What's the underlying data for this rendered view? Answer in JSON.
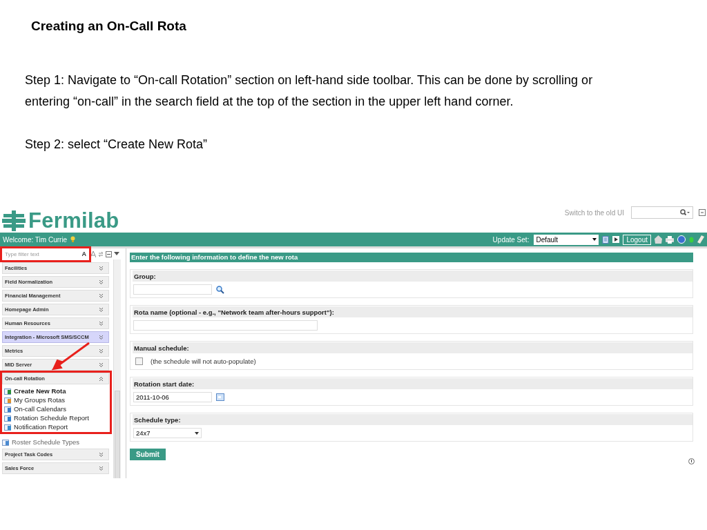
{
  "slide": {
    "title": "Creating an On-Call Rota",
    "steps": [
      "Step 1: Navigate to “On-call Rotation” section on left-hand side toolbar. This can be done by scrolling or entering “on-call” in the search field at the top of the section in the upper left hand corner.",
      "Step 2: select “Create New Rota”"
    ]
  },
  "header": {
    "logo": "Fermilab",
    "switch_link": "Switch to the old UI"
  },
  "banner": {
    "welcome": "Welcome: Tim Currie",
    "update_set_label": "Update Set:",
    "update_set_value": "Default",
    "logout": "Logout"
  },
  "sidebar": {
    "filter_placeholder": "Type filter text",
    "font_button": "A",
    "sections": [
      {
        "kind": "header",
        "label": "Facilities",
        "expanded": false,
        "selected": false
      },
      {
        "kind": "header",
        "label": "Field Normalization",
        "expanded": false,
        "selected": false
      },
      {
        "kind": "header",
        "label": "Financial Management",
        "expanded": false,
        "selected": false
      },
      {
        "kind": "header",
        "label": "Homepage Admin",
        "expanded": false,
        "selected": false
      },
      {
        "kind": "header",
        "label": "Human Resources",
        "expanded": false,
        "selected": false
      },
      {
        "kind": "header",
        "label": "Integration - Microsoft SMS/SCCM",
        "expanded": false,
        "selected": true
      },
      {
        "kind": "header",
        "label": "Metrics",
        "expanded": false,
        "selected": false
      },
      {
        "kind": "header",
        "label": "MID Server",
        "expanded": false,
        "selected": false
      },
      {
        "kind": "header",
        "label": "On-call Rotation",
        "expanded": true,
        "selected": false,
        "items": [
          {
            "label": "Create New Rota",
            "selected": true
          },
          {
            "label": "My Groups Rotas",
            "selected": false
          },
          {
            "label": "On-call Calendars",
            "selected": false
          },
          {
            "label": "Rotation Schedule Report",
            "selected": false
          },
          {
            "label": "Notification Report",
            "selected": false
          }
        ]
      },
      {
        "kind": "link",
        "label": "Roster Schedule Types"
      },
      {
        "kind": "header",
        "label": "Project Task Codes",
        "expanded": false,
        "selected": false
      },
      {
        "kind": "header",
        "label": "Sales Force",
        "expanded": false,
        "selected": false
      }
    ]
  },
  "form": {
    "title": "Enter the following information to define the new rota",
    "fields": [
      {
        "kind": "lookup",
        "label": "Group:"
      },
      {
        "kind": "text",
        "label": "Rota name (optional - e.g., \"Network team after-hours support\"):"
      },
      {
        "kind": "checkbox",
        "label": "Manual schedule:",
        "note": "(the schedule will not auto-populate)",
        "checked": false
      },
      {
        "kind": "date",
        "label": "Rotation start date:",
        "value": "2011-10-06"
      },
      {
        "kind": "select",
        "label": "Schedule type:",
        "value": "24x7"
      }
    ],
    "submit": "Submit"
  }
}
